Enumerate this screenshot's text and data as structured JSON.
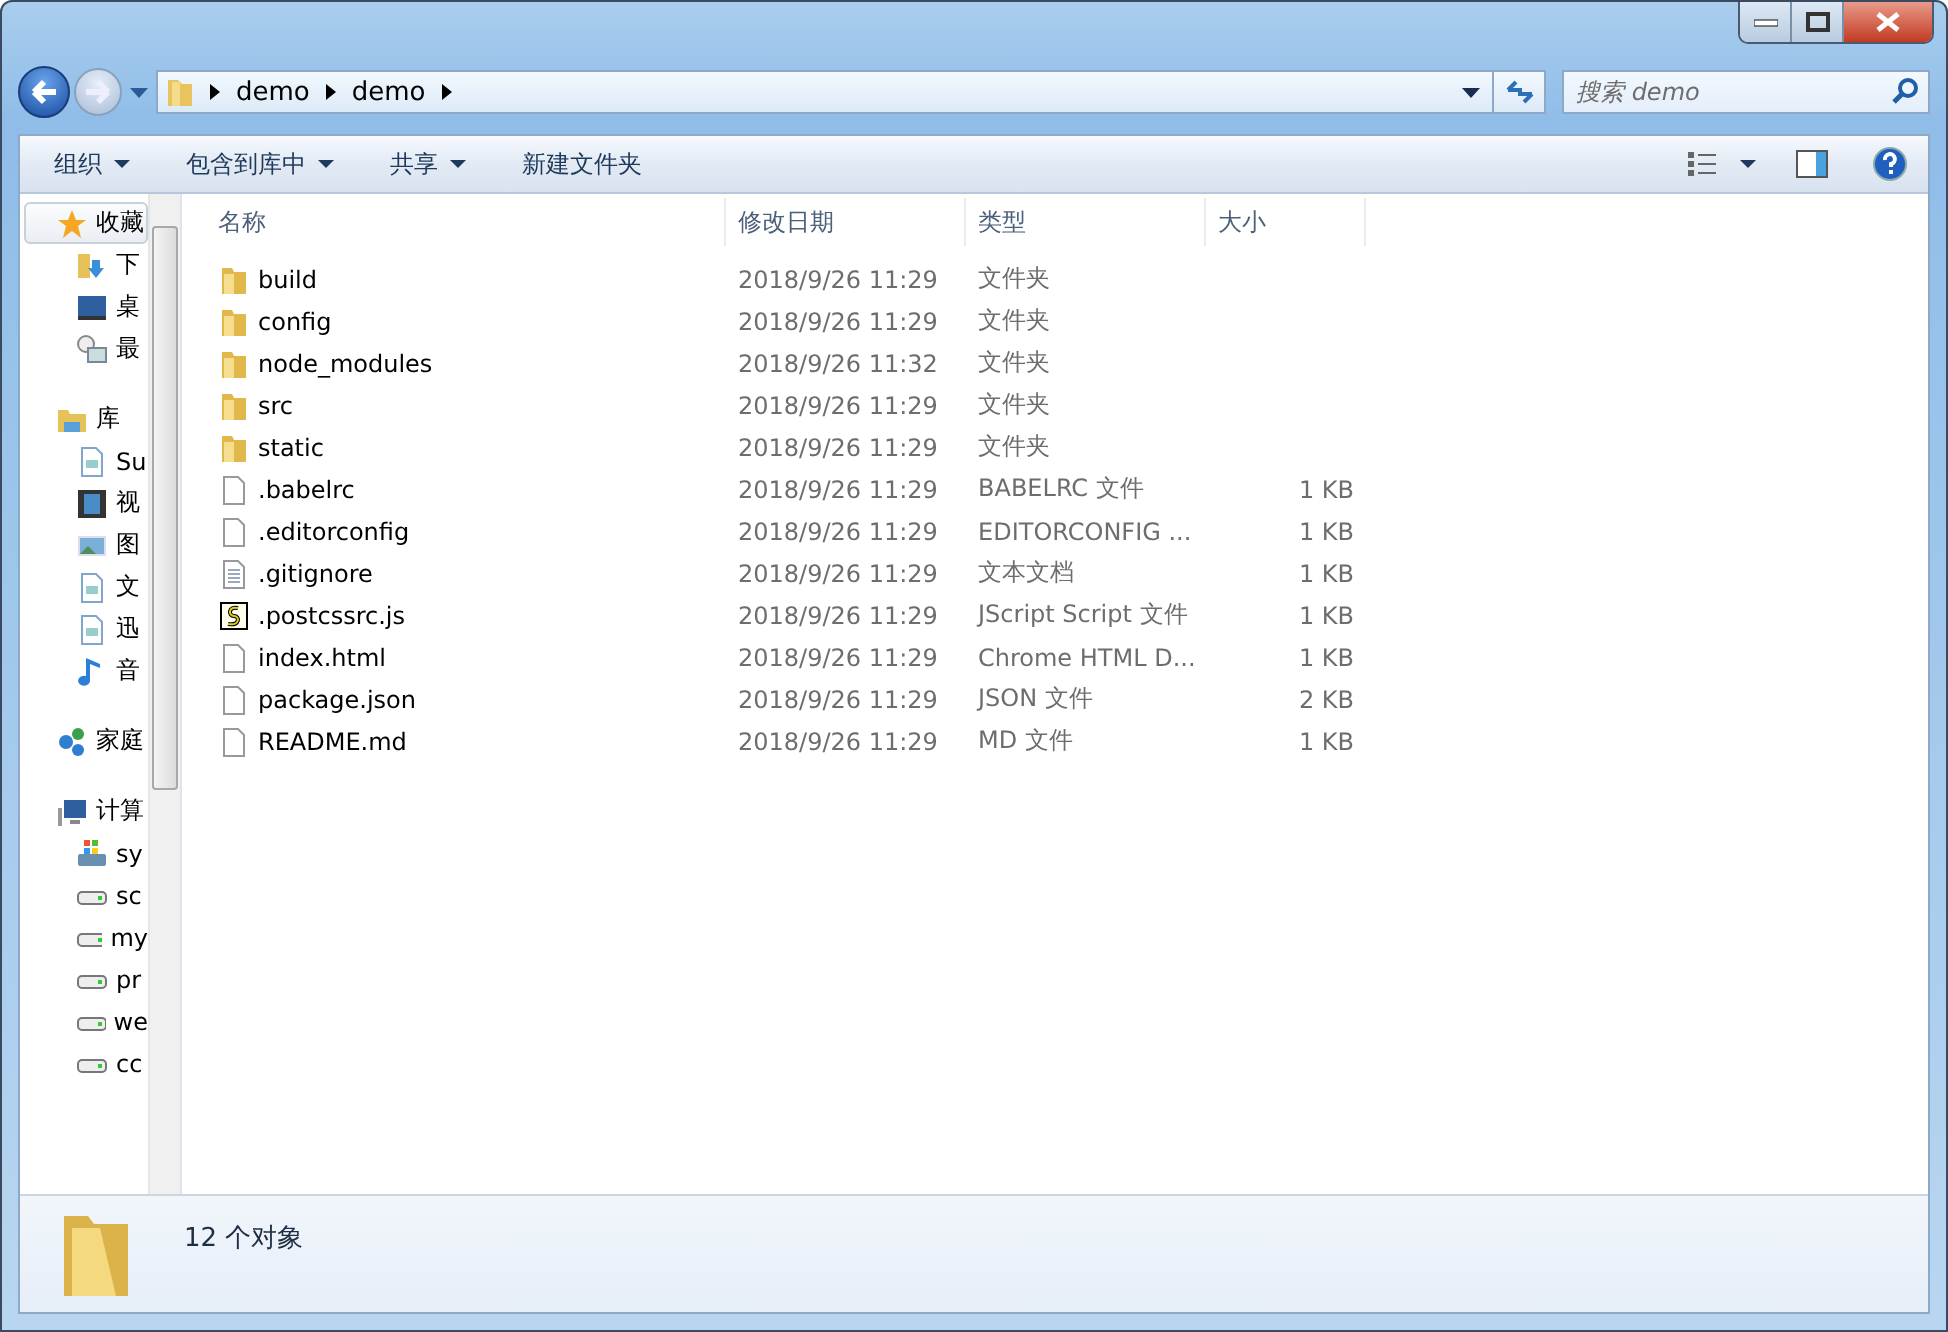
{
  "address": {
    "segments": [
      "demo",
      "demo"
    ]
  },
  "search": {
    "placeholder": "搜索 demo"
  },
  "toolbar": {
    "items": [
      {
        "label": "组织",
        "dropdown": true
      },
      {
        "label": "包含到库中",
        "dropdown": true
      },
      {
        "label": "共享",
        "dropdown": true
      },
      {
        "label": "新建文件夹",
        "dropdown": false
      }
    ]
  },
  "sidebar": {
    "groups": [
      {
        "label": "收藏",
        "kind": "favorites",
        "selected": true,
        "children": [
          {
            "label": "下",
            "kind": "downloads"
          },
          {
            "label": "桌",
            "kind": "desktop"
          },
          {
            "label": "最",
            "kind": "recent"
          }
        ]
      },
      {
        "label": "库",
        "kind": "library",
        "selected": false,
        "children": [
          {
            "label": "Su",
            "kind": "document"
          },
          {
            "label": "视",
            "kind": "video"
          },
          {
            "label": "图",
            "kind": "image"
          },
          {
            "label": "文",
            "kind": "document"
          },
          {
            "label": "迅",
            "kind": "document"
          },
          {
            "label": "音",
            "kind": "music"
          }
        ]
      },
      {
        "label": "家庭",
        "kind": "homegroup",
        "selected": false
      },
      {
        "label": "计算",
        "kind": "computer",
        "selected": false,
        "children": [
          {
            "label": "sy",
            "kind": "system-drive"
          },
          {
            "label": "sc",
            "kind": "drive"
          },
          {
            "label": "my",
            "kind": "drive"
          },
          {
            "label": "pr",
            "kind": "drive"
          },
          {
            "label": "we",
            "kind": "drive"
          },
          {
            "label": "cc",
            "kind": "drive"
          }
        ]
      }
    ]
  },
  "table": {
    "columns": [
      "名称",
      "修改日期",
      "类型",
      "大小"
    ],
    "rows": [
      {
        "name": "build",
        "date": "2018/9/26 11:29",
        "type": "文件夹",
        "kind": "folder"
      },
      {
        "name": "config",
        "date": "2018/9/26 11:29",
        "type": "文件夹",
        "kind": "folder"
      },
      {
        "name": "node_modules",
        "date": "2018/9/26 11:32",
        "type": "文件夹",
        "kind": "folder"
      },
      {
        "name": "src",
        "date": "2018/9/26 11:29",
        "type": "文件夹",
        "kind": "folder"
      },
      {
        "name": "static",
        "date": "2018/9/26 11:29",
        "type": "文件夹",
        "kind": "folder"
      },
      {
        "name": ".babelrc",
        "date": "2018/9/26 11:29",
        "type": "BABELRC 文件",
        "size": "1 KB",
        "kind": "file"
      },
      {
        "name": ".editorconfig",
        "date": "2018/9/26 11:29",
        "type": "EDITORCONFIG ...",
        "size": "1 KB",
        "kind": "file"
      },
      {
        "name": ".gitignore",
        "date": "2018/9/26 11:29",
        "type": "文本文档",
        "size": "1 KB",
        "kind": "text"
      },
      {
        "name": ".postcssrc.js",
        "date": "2018/9/26 11:29",
        "type": "JScript Script 文件",
        "size": "1 KB",
        "kind": "script"
      },
      {
        "name": "index.html",
        "date": "2018/9/26 11:29",
        "type": "Chrome HTML D...",
        "size": "1 KB",
        "kind": "file"
      },
      {
        "name": "package.json",
        "date": "2018/9/26 11:29",
        "type": "JSON 文件",
        "size": "2 KB",
        "kind": "file"
      },
      {
        "name": "README.md",
        "date": "2018/9/26 11:29",
        "type": "MD 文件",
        "size": "1 KB",
        "kind": "file"
      }
    ]
  },
  "status_bar": {
    "count": "12 个对象"
  }
}
